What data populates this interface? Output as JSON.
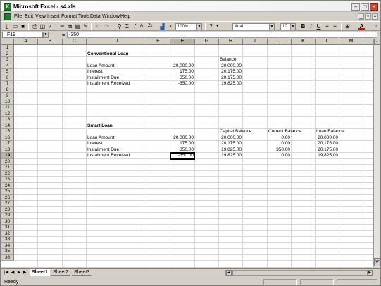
{
  "window": {
    "title": "Microsoft Excel - s4.xls",
    "app_icon": "X"
  },
  "menus": [
    "File",
    "Edit",
    "View",
    "Insert",
    "Format",
    "Tools",
    "Data",
    "Window",
    "Help"
  ],
  "toolbar": {
    "zoom": "100%",
    "font": "Arial",
    "size": "10"
  },
  "formula": {
    "name_box": "F19",
    "equals": "=",
    "content": "-350"
  },
  "columns": [
    "A",
    "B",
    "C",
    "D",
    "E",
    "F",
    "G",
    "H",
    "I",
    "J",
    "K",
    "L",
    "M",
    "N"
  ],
  "selected_column": "F",
  "rows": [
    "1",
    "2",
    "3",
    "4",
    "5",
    "6",
    "7",
    "8",
    "9",
    "10",
    "11",
    "12",
    "13",
    "14",
    "15",
    "16",
    "17",
    "18",
    "19",
    "20",
    "21",
    "22",
    "23",
    "24",
    "25",
    "26",
    "27",
    "28",
    "29",
    "30",
    "31",
    "32",
    "33",
    "34",
    "35",
    "36"
  ],
  "selected_row": "19",
  "cells": {
    "D2": "Conventional Loan",
    "H3": "Balance",
    "D4": "Loan Amount",
    "F4": "20,000.00",
    "H4": "20,000.00",
    "D5": "Interest",
    "F5": "175.00",
    "H5": "20,175.00",
    "D6": "Installment Due",
    "F6": "350.00",
    "H6": "20,175.00",
    "D7": "Installment Received",
    "F7": "-350.00",
    "H7": "19,825.00",
    "D14": "Smart Loan",
    "H15": "Capital Balance",
    "J15": "Current Balance",
    "L15": "Loan Balance",
    "D16": "Loan Amount",
    "F16": "20,000.00",
    "H16": "20,000.00",
    "J16": "0.00",
    "L16": "20,000.00",
    "D17": "Interest",
    "F17": "175.00",
    "H17": "20,175.00",
    "J17": "0.00",
    "L17": "20,175.00",
    "D18": "Installment Due",
    "F18": "350.00",
    "H18": "19,825.00",
    "J18": "350.00",
    "L18": "20,175.00",
    "D19": "Installment Received",
    "F19": "-350.00",
    "H19": "19,825.00",
    "J19": "0.00",
    "L19": "19,825.00"
  },
  "sheets": [
    "Sheet1",
    "Sheet2",
    "Sheet3"
  ],
  "active_sheet": "Sheet1",
  "status": "Ready"
}
